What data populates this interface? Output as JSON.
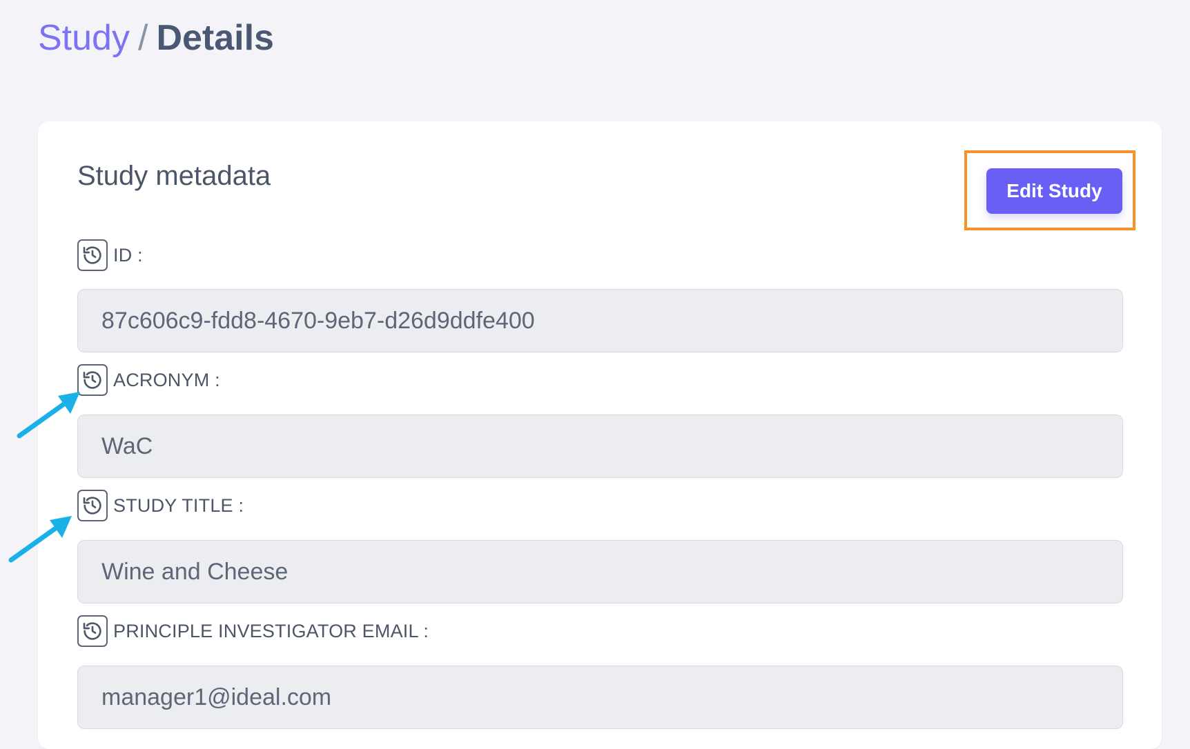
{
  "breadcrumb": {
    "parent": "Study",
    "separator": "/",
    "current": "Details"
  },
  "card": {
    "title": "Study metadata",
    "edit_button_label": "Edit Study"
  },
  "fields": [
    {
      "label": "ID :",
      "value": "87c606c9-fdd8-4670-9eb7-d26d9ddfe400"
    },
    {
      "label": "ACRONYM :",
      "value": "WaC"
    },
    {
      "label": "STUDY TITLE :",
      "value": "Wine and Cheese"
    },
    {
      "label": "PRINCIPLE INVESTIGATOR EMAIL :",
      "value": "manager1@ideal.com"
    }
  ],
  "colors": {
    "accent": "#6a5ff5",
    "breadcrumb_link": "#7b73f2",
    "highlight_box": "#f7922a",
    "annotation_arrow": "#1ab0e8",
    "field_background": "#ecedf1",
    "page_background": "#f4f4f8"
  },
  "icons": {
    "field_icon": "history-icon",
    "annotation": "arrow-icon"
  }
}
